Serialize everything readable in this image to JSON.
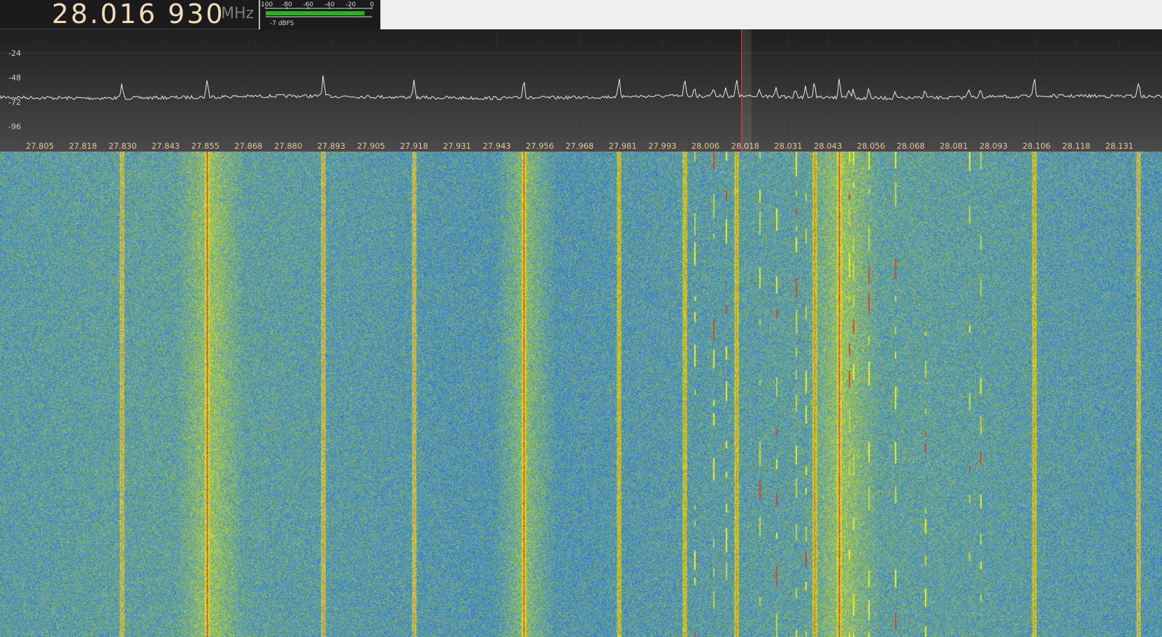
{
  "frequency_display": {
    "digits": "28.016 930",
    "unit": "MHz"
  },
  "smeter": {
    "scale_labels": [
      "-100",
      "-80",
      "-60",
      "-40",
      "-20",
      "0"
    ],
    "level_fraction": 0.93,
    "readout": "-7 dBFS",
    "bar_color": "#27b51f"
  },
  "panadapter": {
    "db_labels": [
      "-24",
      "-48",
      "-72",
      "-96"
    ],
    "freq_labels": [
      "27.805",
      "27.818",
      "27.830",
      "27.843",
      "27.855",
      "27.868",
      "27.880",
      "27.893",
      "27.905",
      "27.918",
      "27.931",
      "27.943",
      "27.956",
      "27.968",
      "27.981",
      "27.993",
      "28.006",
      "28.018",
      "28.031",
      "28.043",
      "28.056",
      "28.068",
      "28.081",
      "28.093",
      "28.106",
      "28.118",
      "28.131"
    ],
    "tuning_marker_freq": 28.01693,
    "trace_color": "#ffffff",
    "label_color": "#e6c79a",
    "marker_color": "#e05050"
  },
  "waterfall": {
    "palette": [
      "#1f52d6",
      "#3f8ac6",
      "#7bb07c",
      "#c8d93a",
      "#f0ee18",
      "#e8a21f",
      "#d24a1e"
    ],
    "strong_carriers_mhz": [
      27.8297,
      27.8555,
      27.8906,
      27.9179,
      27.9511,
      27.9799,
      27.9997,
      28.0154,
      28.0389,
      28.0464,
      28.1053,
      28.1368
    ],
    "intermittent_signals_mhz": [
      28.0027,
      28.0083,
      28.0121,
      28.0223,
      28.0274,
      28.0332,
      28.0362,
      28.0493,
      28.0506,
      28.0553,
      28.0632,
      28.0722,
      28.0855,
      28.089
    ],
    "noise_bands_mhz": [
      [
        27.85,
        27.863
      ],
      [
        27.946,
        27.957
      ],
      [
        28.04,
        28.055
      ]
    ]
  }
}
